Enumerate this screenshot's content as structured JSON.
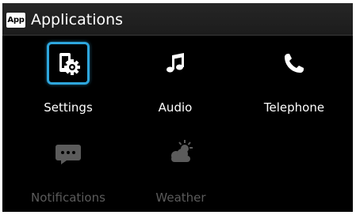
{
  "header": {
    "badge": "App",
    "title": "Applications"
  },
  "apps": [
    {
      "label": "Settings",
      "icon": "settings-icon",
      "selected": true,
      "enabled": true
    },
    {
      "label": "Audio",
      "icon": "music-note-icon",
      "selected": false,
      "enabled": true
    },
    {
      "label": "Telephone",
      "icon": "phone-icon",
      "selected": false,
      "enabled": true
    },
    {
      "label": "Notifications",
      "icon": "chat-bubble-icon",
      "selected": false,
      "enabled": false
    },
    {
      "label": "Weather",
      "icon": "weather-icon",
      "selected": false,
      "enabled": false
    }
  ],
  "colors": {
    "background": "#000000",
    "header": "#222222",
    "focus": "#2ea6dd",
    "text": "#ffffff",
    "disabled": "#5b5b5b"
  }
}
